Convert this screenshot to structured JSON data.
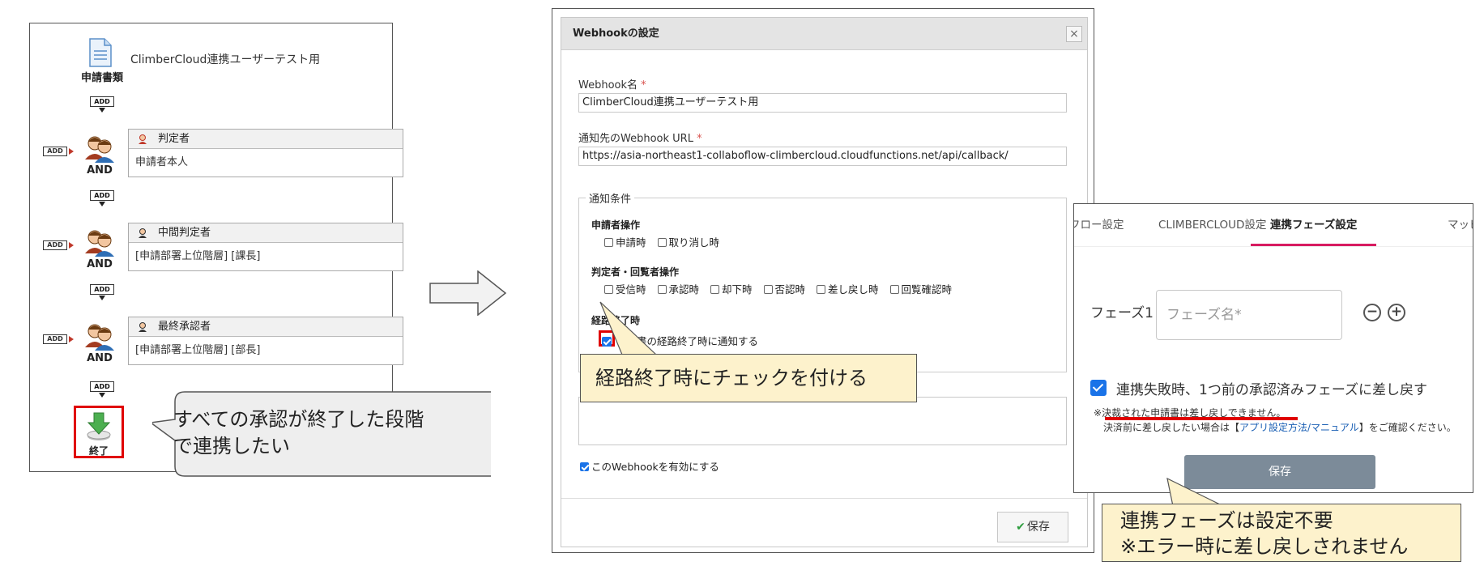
{
  "route": {
    "form_type_label": "申請書類",
    "form_name": "ClimberCloud連携ユーザーテスト用",
    "add_label": "ADD",
    "and_label": "AND",
    "steps": [
      {
        "title": "判定者",
        "value": "申請者本人"
      },
      {
        "title": "中間判定者",
        "value": "[申請部署上位階層] [課長]"
      },
      {
        "title": "最終承認者",
        "value": "[申請部署上位階層] [部長]"
      }
    ],
    "end_label": "終了",
    "callout_line1": "すべての承認が終了した段階",
    "callout_line2": "で連携したい"
  },
  "dialog": {
    "title": "Webhookの設定",
    "close_symbol": "×",
    "name_label": "Webhook名",
    "required_mark": "*",
    "name_value": "ClimberCloud連携ユーザーテスト用",
    "url_label": "通知先のWebhook URL",
    "url_value": "https://asia-northeast1-collaboflow-climbercloud.cloudfunctions.net/api/callback/",
    "conditions_legend": "通知条件",
    "applicant_ops_title": "申請者操作",
    "applicant_ops": [
      "申請時",
      "取り消し時"
    ],
    "judge_ops_title": "判定者・回覧者操作",
    "judge_ops": [
      "受信時",
      "承認時",
      "却下時",
      "否認時",
      "差し戻し時",
      "回覧確認時"
    ],
    "route_end_title": "経路終了時",
    "route_end_option": "申請書の経路終了時に通知する",
    "enable_label": "このWebhookを有効にする",
    "save_label": "保存"
  },
  "note_check": "経路終了時にチェックを付ける",
  "settings": {
    "tabs": [
      "フロー設定",
      "CLIMBERCLOUD設定",
      "連携フェーズ設定",
      "マッピ"
    ],
    "phase_label": "フェーズ1",
    "phase_placeholder": "フェーズ名*",
    "minus_symbol": "−",
    "plus_symbol": "+",
    "rollback_label": "連携失敗時、1つ前の承認済みフェーズに差し戻す",
    "note_prefix": "※",
    "note_emphasis": "決裁された申請書は差し戻しできません。",
    "note2_before": "決済前に差し戻したい場合は【",
    "note2_link": "アプリ設定方法/マニュアル",
    "note2_after": "】をご確認ください。",
    "save_label": "保存"
  },
  "note_phase_line1": "連携フェーズは設定不要",
  "note_phase_line2": "※エラー時に差し戻しされません",
  "colors": {
    "highlight_red": "#e00000",
    "note_yellow": "#fdf2cc",
    "tab_accent": "#d81b60",
    "checkbox_blue": "#1a73e8",
    "panel_button": "#7c8b99"
  }
}
